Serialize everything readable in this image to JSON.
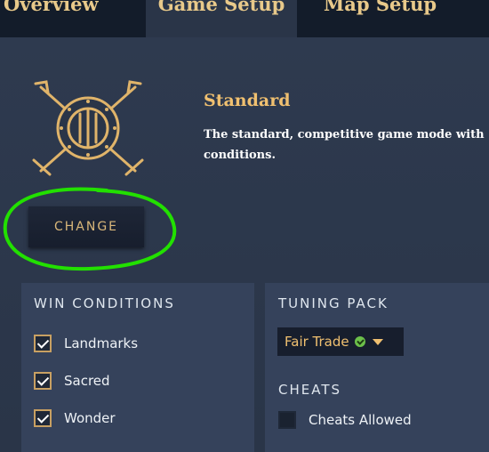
{
  "tabs": {
    "overview": "Overview",
    "game_setup": "Game Setup",
    "map_setup": "Map Setup"
  },
  "game_mode": {
    "emblem_icon": "crossed-swords-shield-icon",
    "title": "Standard",
    "description": "The standard, competitive game mode with conditions."
  },
  "change_button": "CHANGE",
  "win_conditions": {
    "heading": "WIN CONDITIONS",
    "items": [
      {
        "label": "Landmarks",
        "checked": true
      },
      {
        "label": "Sacred",
        "checked": true
      },
      {
        "label": "Wonder",
        "checked": true
      }
    ]
  },
  "tuning_pack": {
    "heading": "TUNING PACK",
    "selected": "Fair Trade",
    "status_icon": "green-check-icon",
    "arrow_icon": "chevron-down-icon"
  },
  "cheats": {
    "heading": "CHEATS",
    "items": [
      {
        "label": "Cheats Allowed",
        "checked": false
      }
    ]
  },
  "colors": {
    "accent_gold": "#f0c070",
    "annotation_green": "#22e000",
    "panel_bg": "#2a3548",
    "tabbar_bg": "#131c2a"
  }
}
